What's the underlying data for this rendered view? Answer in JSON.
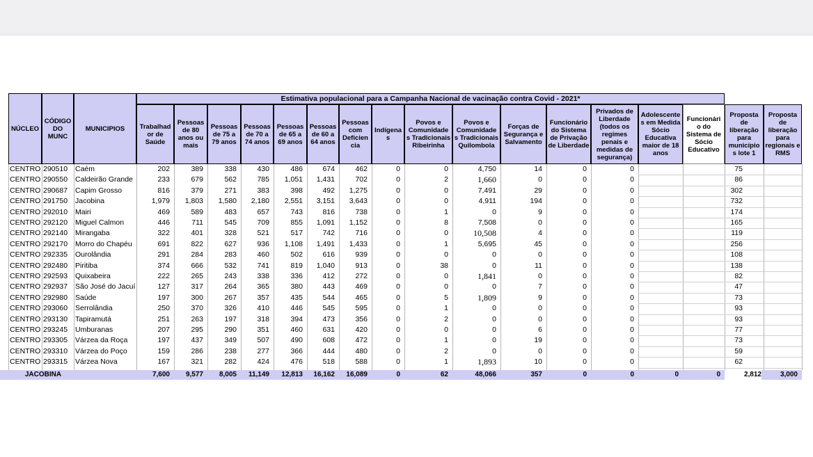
{
  "table": {
    "title": "Estimativa populacional para a Campanha Nacional de vacinação contra Covid - 2021*",
    "headers": [
      "NÚCLEO",
      "CÓDIGO DO MUNC",
      "MUNICIPIOS",
      "Trabalhad or de Saúde",
      "Pessoas de 80 anos ou mais",
      "Pessoas de 75 a 79 anos",
      "Pessoas de 70 a 74 anos",
      "Pessoas de 65 a 69 anos",
      "Pessoas de 60 a 64 anos",
      "Pessoas com Deficien cia",
      "Indígena s",
      "Povos e Comunidade s Tradicionais Ribeirinha",
      "Povos e Comunidade s Tradicionais Quilombola",
      "Forças de Segurança e Salvamento",
      "Funcionário do Sistema de Privação de Liberdade",
      "Privados de Liberdade (todos os regimes penais e medidas de segurança)",
      "Adolescente s em Medida Sócio Educativa maior de 18 anos",
      "Funcionári o do Sistema de Sócio Educativo",
      "Proposta de liberação para município s lote 1",
      "Proposta de liberação para regionais e RMS"
    ],
    "rows": [
      [
        "CENTRO",
        "290510",
        "Caém",
        "202",
        "389",
        "338",
        "430",
        "486",
        "674",
        "462",
        "0",
        "0",
        "4,750",
        "14",
        "0",
        "0",
        "",
        "",
        "75",
        ""
      ],
      [
        "CENTRO",
        "290550",
        "Caldeirão Grande",
        "233",
        "679",
        "562",
        "785",
        "1,051",
        "1,431",
        "702",
        "0",
        "2",
        "1,660",
        "0",
        "0",
        "0",
        "",
        "",
        "86",
        ""
      ],
      [
        "CENTRO",
        "290687",
        "Capim Grosso",
        "816",
        "379",
        "271",
        "383",
        "398",
        "492",
        "1,275",
        "0",
        "0",
        "7,491",
        "29",
        "0",
        "0",
        "",
        "",
        "302",
        ""
      ],
      [
        "CENTRO",
        "291750",
        "Jacobina",
        "1,979",
        "1,803",
        "1,580",
        "2,180",
        "2,551",
        "3,151",
        "3,643",
        "0",
        "0",
        "4,911",
        "194",
        "0",
        "0",
        "",
        "",
        "732",
        ""
      ],
      [
        "CENTRO",
        "292010",
        "Mairi",
        "469",
        "589",
        "483",
        "657",
        "743",
        "816",
        "738",
        "0",
        "1",
        "0",
        "9",
        "0",
        "0",
        "",
        "",
        "174",
        ""
      ],
      [
        "CENTRO",
        "292120",
        "Miguel Calmon",
        "446",
        "711",
        "545",
        "709",
        "855",
        "1,091",
        "1,152",
        "0",
        "8",
        "7,508",
        "0",
        "0",
        "0",
        "",
        "",
        "165",
        ""
      ],
      [
        "CENTRO",
        "292140",
        "Mirangaba",
        "322",
        "401",
        "328",
        "521",
        "517",
        "742",
        "716",
        "0",
        "0",
        "10,508",
        "4",
        "0",
        "0",
        "",
        "",
        "119",
        ""
      ],
      [
        "CENTRO",
        "292170",
        "Morro do Chapéu",
        "691",
        "822",
        "627",
        "936",
        "1,108",
        "1,491",
        "1,433",
        "0",
        "1",
        "5,695",
        "45",
        "0",
        "0",
        "",
        "",
        "256",
        ""
      ],
      [
        "CENTRO",
        "292335",
        "Ourolândia",
        "291",
        "284",
        "283",
        "460",
        "502",
        "616",
        "939",
        "0",
        "0",
        "0",
        "0",
        "0",
        "0",
        "",
        "",
        "108",
        ""
      ],
      [
        "CENTRO",
        "292480",
        "Piritiba",
        "374",
        "666",
        "532",
        "741",
        "819",
        "1,040",
        "913",
        "0",
        "38",
        "0",
        "11",
        "0",
        "0",
        "",
        "",
        "138",
        ""
      ],
      [
        "CENTRO",
        "292593",
        "Quixabeira",
        "222",
        "265",
        "243",
        "338",
        "336",
        "412",
        "272",
        "0",
        "0",
        "1,841",
        "0",
        "0",
        "0",
        "",
        "",
        "82",
        ""
      ],
      [
        "CENTRO",
        "292937",
        "São José do Jacuí",
        "127",
        "317",
        "264",
        "365",
        "380",
        "443",
        "469",
        "0",
        "0",
        "0",
        "7",
        "0",
        "0",
        "",
        "",
        "47",
        ""
      ],
      [
        "CENTRO",
        "292980",
        "Saúde",
        "197",
        "300",
        "267",
        "357",
        "435",
        "544",
        "465",
        "0",
        "5",
        "1,809",
        "9",
        "0",
        "0",
        "",
        "",
        "73",
        ""
      ],
      [
        "CENTRO",
        "293060",
        "Serrolândia",
        "250",
        "370",
        "326",
        "410",
        "446",
        "545",
        "595",
        "0",
        "1",
        "0",
        "0",
        "0",
        "0",
        "",
        "",
        "93",
        ""
      ],
      [
        "CENTRO",
        "293130",
        "Tapiramutá",
        "251",
        "263",
        "197",
        "318",
        "394",
        "473",
        "356",
        "0",
        "2",
        "0",
        "0",
        "0",
        "0",
        "",
        "",
        "93",
        ""
      ],
      [
        "CENTRO",
        "293245",
        "Umburanas",
        "207",
        "295",
        "290",
        "351",
        "460",
        "631",
        "420",
        "0",
        "0",
        "0",
        "6",
        "0",
        "0",
        "",
        "",
        "77",
        ""
      ],
      [
        "CENTRO",
        "293305",
        "Várzea da Roça",
        "197",
        "437",
        "349",
        "507",
        "490",
        "608",
        "472",
        "0",
        "1",
        "0",
        "19",
        "0",
        "0",
        "",
        "",
        "73",
        ""
      ],
      [
        "CENTRO",
        "293310",
        "Várzea do Poço",
        "159",
        "286",
        "238",
        "277",
        "366",
        "444",
        "480",
        "0",
        "2",
        "0",
        "0",
        "0",
        "0",
        "",
        "",
        "59",
        ""
      ],
      [
        "CENTRO",
        "293315",
        "Várzea Nova",
        "167",
        "321",
        "282",
        "424",
        "476",
        "518",
        "588",
        "0",
        "1",
        "1,893",
        "10",
        "0",
        "0",
        "",
        "",
        "62",
        ""
      ]
    ],
    "total_label": "JACOBINA",
    "totals": [
      "7,600",
      "9,577",
      "8,005",
      "11,149",
      "12,813",
      "16,162",
      "16,089",
      "0",
      "62",
      "48,066",
      "357",
      "0",
      "0",
      "0",
      "0",
      "2,812",
      "3,000"
    ]
  }
}
